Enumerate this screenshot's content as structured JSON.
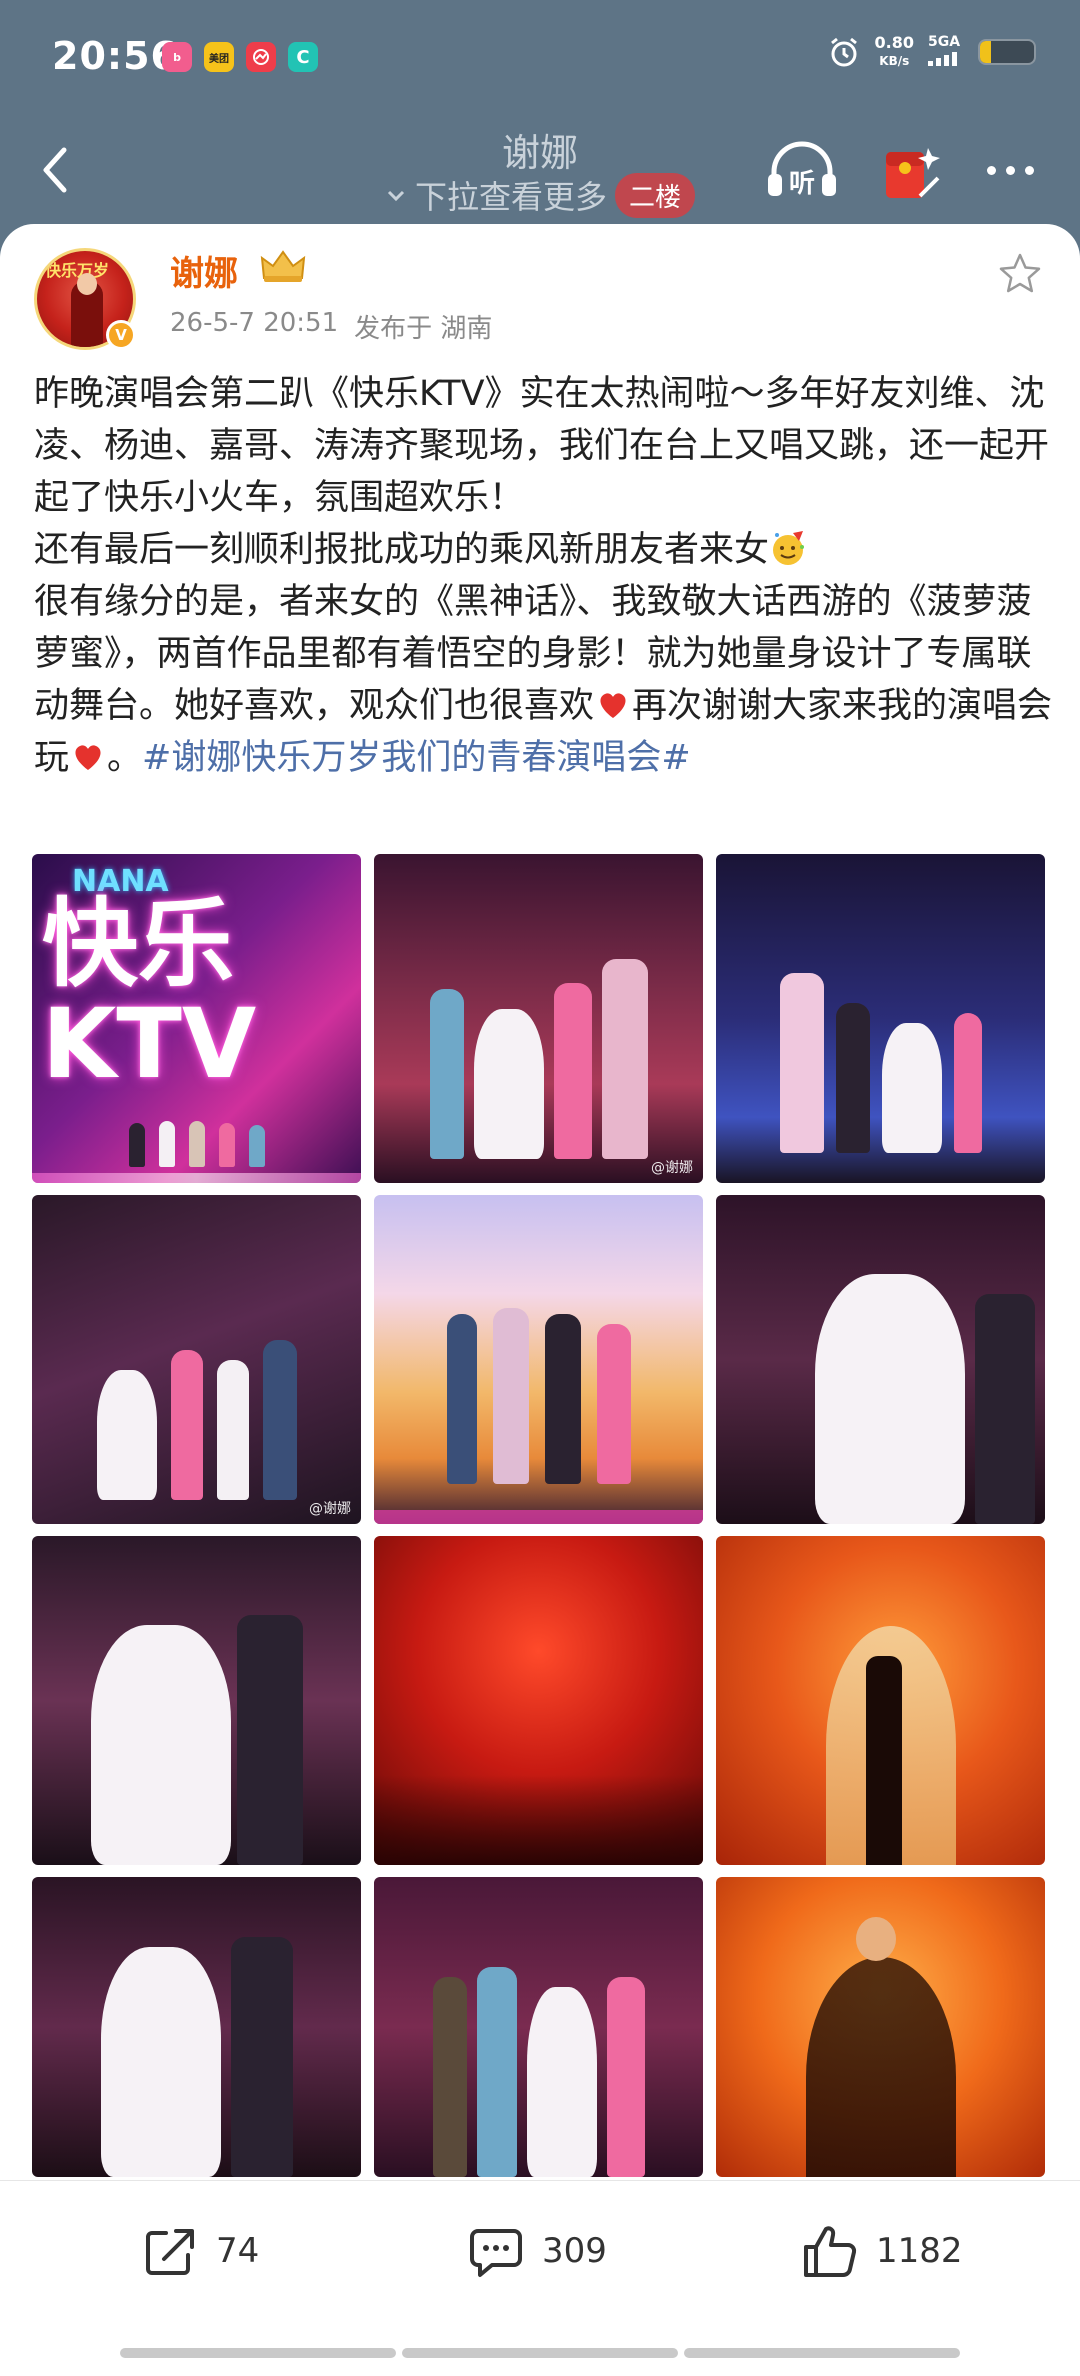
{
  "status_bar": {
    "time": "20:56",
    "apps": [
      {
        "name": "bilibili",
        "label": "b",
        "color": "#f25d8e"
      },
      {
        "name": "meituan",
        "label": "美团",
        "color": "#f6c31a"
      },
      {
        "name": "app-red",
        "label": "",
        "color": "#ef3d4a"
      },
      {
        "name": "app-teal",
        "label": "C",
        "color": "#22c3b4"
      }
    ],
    "net_speed_value": "0.80",
    "net_speed_unit": "KB/s",
    "signal": "5GA",
    "battery_level": 0.2
  },
  "nav": {
    "title": "谢娜",
    "subtitle": "下拉查看更多",
    "floor_badge": "二楼"
  },
  "post": {
    "username": "谢娜",
    "avatar_text": "快乐万岁",
    "date": "26-5-7 20:51",
    "location": "发布于 湖南",
    "text_part1": "昨晚演唱会第二趴《快乐KTV》实在太热闹啦～多年好友刘维、沈凌、杨迪、嘉哥、涛涛齐聚现场，我们在台上又唱又跳，还一起开起了快乐小火车，氛围超欢乐！",
    "text_part2": "还有最后一刻顺利报批成功的乘风新朋友者来女",
    "text_part3": "很有缘分的是，者来女的《黑神话》、我致敬大话西游的《菠萝菠萝蜜》，两首作品里都有着悟空的身影！就为她量身设计了专属联动舞台。她好喜欢，观众们也很喜欢",
    "text_part4": "再次谢谢大家来我的演唱会玩",
    "text_part5": "。",
    "topic": "#谢娜快乐万岁我们的青春演唱会#",
    "images": {
      "p1_nana": "NANA",
      "p1_ktv": "快乐\nKTV",
      "watermark": "@谢娜"
    }
  },
  "actions": {
    "repost_count": "74",
    "comment_count": "309",
    "like_count": "1182"
  }
}
